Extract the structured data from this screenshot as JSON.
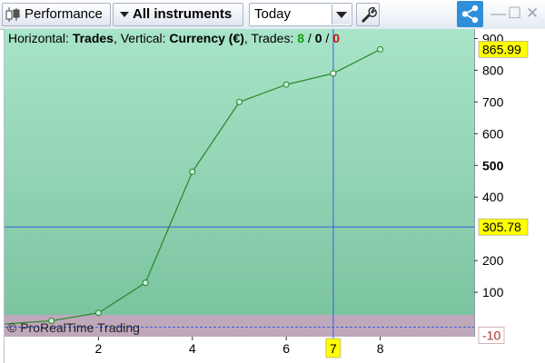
{
  "toolbar": {
    "title": "Performance",
    "instruments_label": "All instruments",
    "period_value": "Today"
  },
  "colors": {
    "plot_bg_top": "#a8e4c8",
    "plot_bg_bottom": "#7cc4a0",
    "line": "#2e8b2e",
    "crosshair": "#3a5fe0",
    "price_label_bg": "#ffff00",
    "negative_band": "#bfa8ba",
    "trades_win": "#1a9c1a",
    "trades_loss": "#c21515",
    "share_button": "#2f8fd8"
  },
  "chart_data": {
    "type": "line",
    "header": {
      "horizontal_label": "Horizontal: ",
      "horizontal_value": "Trades",
      "vertical_label": ", Vertical: ",
      "vertical_value": "Currency (€)",
      "trades_label": ", Trades: ",
      "trades_win": "8",
      "sep1": " / ",
      "trades_neutral": "0",
      "sep2": " / ",
      "trades_loss": "0"
    },
    "x": [
      0,
      1,
      2,
      3,
      4,
      5,
      6,
      7,
      8
    ],
    "y": [
      0,
      10,
      35,
      130,
      480,
      700,
      755,
      790,
      865.99
    ],
    "xlim": [
      0,
      10
    ],
    "ylim": [
      -40,
      930
    ],
    "x_ticks": [
      {
        "value": 2,
        "label": "2"
      },
      {
        "value": 4,
        "label": "4"
      },
      {
        "value": 6,
        "label": "6"
      },
      {
        "value": 8,
        "label": "8"
      }
    ],
    "y_ticks": [
      {
        "value": 900,
        "label": "900",
        "bold": false
      },
      {
        "value": 800,
        "label": "800",
        "bold": false
      },
      {
        "value": 700,
        "label": "700",
        "bold": false
      },
      {
        "value": 600,
        "label": "600",
        "bold": false
      },
      {
        "value": 500,
        "label": "500",
        "bold": true
      },
      {
        "value": 400,
        "label": "400",
        "bold": false
      },
      {
        "value": 200,
        "label": "200",
        "bold": false
      },
      {
        "value": 100,
        "label": "100",
        "bold": false
      }
    ],
    "last_value_label": "865.99",
    "last_value": 865.99,
    "crosshair_x": 7,
    "crosshair_y": 305.78,
    "crosshair_y_label": "305.78",
    "crosshair_x_label": "7",
    "zero_line_label": "-10",
    "zero_line_value": -10,
    "watermark": "© ProRealTime Trading"
  }
}
